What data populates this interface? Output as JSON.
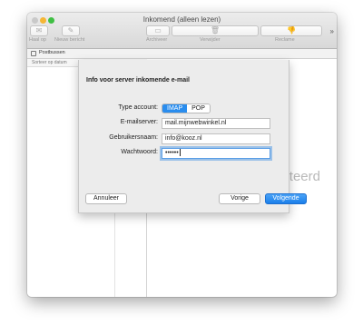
{
  "window": {
    "title": "Inkomend (alleen lezen)"
  },
  "toolbar": {
    "buttons": [
      {
        "label": "Haal op",
        "icon": "envelope-icon"
      },
      {
        "label": "Nieuw bericht",
        "icon": "compose-icon"
      },
      {
        "label": "Archiveer",
        "icon": "archive-icon"
      },
      {
        "label": "Verwijder",
        "icon": "trash-icon"
      },
      {
        "label": "Reclame",
        "icon": "thumbs-down-icon"
      }
    ],
    "overflow": "»"
  },
  "favorites": {
    "mailboxes_label": "Postbussen"
  },
  "message_list": {
    "sort_label": "Sorteer op datum"
  },
  "viewer": {
    "partial_text": "cteerd"
  },
  "dialog": {
    "title": "Info voor server inkomende e-mail",
    "account_type_label": "Type account:",
    "account_types": [
      "IMAP",
      "POP"
    ],
    "account_type_selected": "IMAP",
    "mailserver_label": "E-mailserver:",
    "mailserver_value": "mail.mijnwebwinkel.nl",
    "username_label": "Gebruikersnaam:",
    "username_value": "info@kooz.nl",
    "password_label": "Wachtwoord:",
    "password_masked": "••••••",
    "cancel_label": "Annuleer",
    "back_label": "Vorige",
    "next_label": "Volgende"
  },
  "colors": {
    "accent": "#2a8dee",
    "traffic_close": "#c9c9c9",
    "traffic_minimize": "#f5b634",
    "traffic_maximize": "#3fbf43"
  }
}
